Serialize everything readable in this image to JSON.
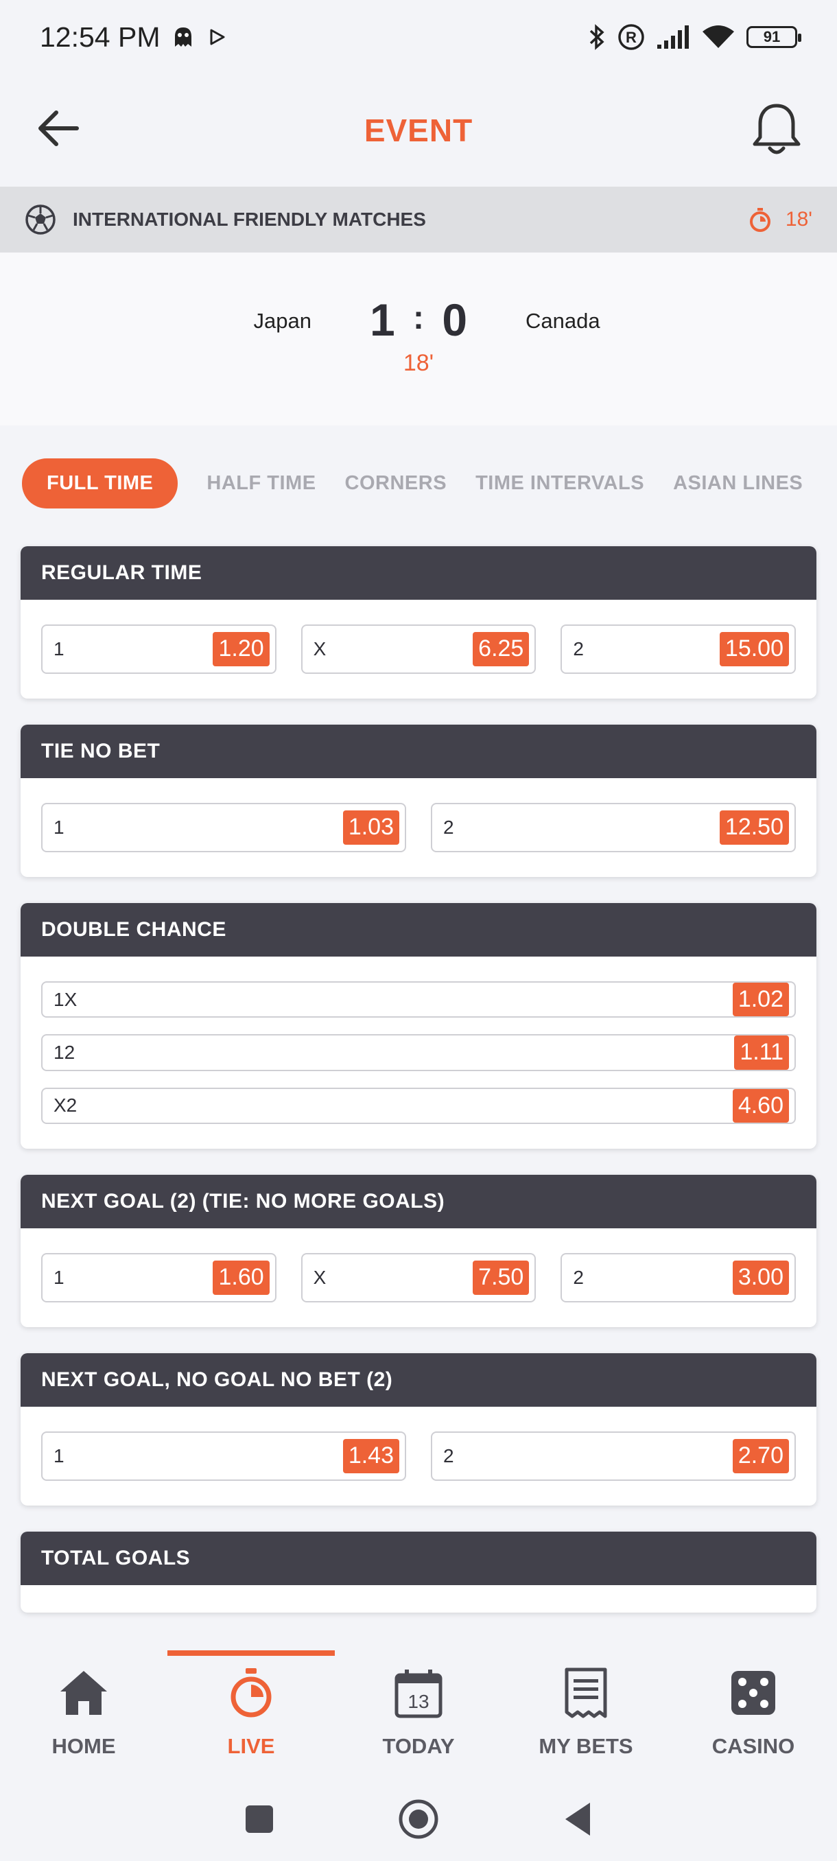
{
  "status_bar": {
    "time": "12:54 PM",
    "battery": "91"
  },
  "header": {
    "title": "EVENT"
  },
  "league": {
    "name": "INTERNATIONAL FRIENDLY MATCHES",
    "minute": "18'"
  },
  "match": {
    "home_team": "Japan",
    "away_team": "Canada",
    "home_score": "1",
    "away_score": "0",
    "separator": ":",
    "minute": "18'"
  },
  "tabs": [
    "FULL TIME",
    "HALF TIME",
    "CORNERS",
    "TIME INTERVALS",
    "ASIAN LINES"
  ],
  "markets": [
    {
      "title": "REGULAR TIME",
      "odds": [
        {
          "label": "1",
          "price": "1.20"
        },
        {
          "label": "X",
          "price": "6.25"
        },
        {
          "label": "2",
          "price": "15.00"
        }
      ]
    },
    {
      "title": "TIE NO BET",
      "odds": [
        {
          "label": "1",
          "price": "1.03"
        },
        {
          "label": "2",
          "price": "12.50"
        }
      ]
    },
    {
      "title": "DOUBLE CHANCE",
      "odds": [
        {
          "label": "1X",
          "price": "1.02"
        },
        {
          "label": "12",
          "price": "1.11"
        },
        {
          "label": "X2",
          "price": "4.60"
        }
      ]
    },
    {
      "title": "NEXT GOAL (2) (TIE: NO MORE GOALS)",
      "odds": [
        {
          "label": "1",
          "price": "1.60"
        },
        {
          "label": "X",
          "price": "7.50"
        },
        {
          "label": "2",
          "price": "3.00"
        }
      ]
    },
    {
      "title": "NEXT GOAL, NO GOAL NO BET (2)",
      "odds": [
        {
          "label": "1",
          "price": "1.43"
        },
        {
          "label": "2",
          "price": "2.70"
        }
      ]
    },
    {
      "title": "TOTAL GOALS"
    }
  ],
  "bottom_nav": [
    {
      "label": "HOME",
      "icon": "home-icon"
    },
    {
      "label": "LIVE",
      "icon": "stopwatch-icon",
      "active": true
    },
    {
      "label": "TODAY",
      "icon": "calendar-icon",
      "calendar_day": "13"
    },
    {
      "label": "MY BETS",
      "icon": "bet-slip-icon"
    },
    {
      "label": "CASINO",
      "icon": "dice-icon"
    }
  ],
  "colors": {
    "accent": "#ee6237",
    "market_header": "#42414b",
    "background": "#f3f4f8"
  }
}
